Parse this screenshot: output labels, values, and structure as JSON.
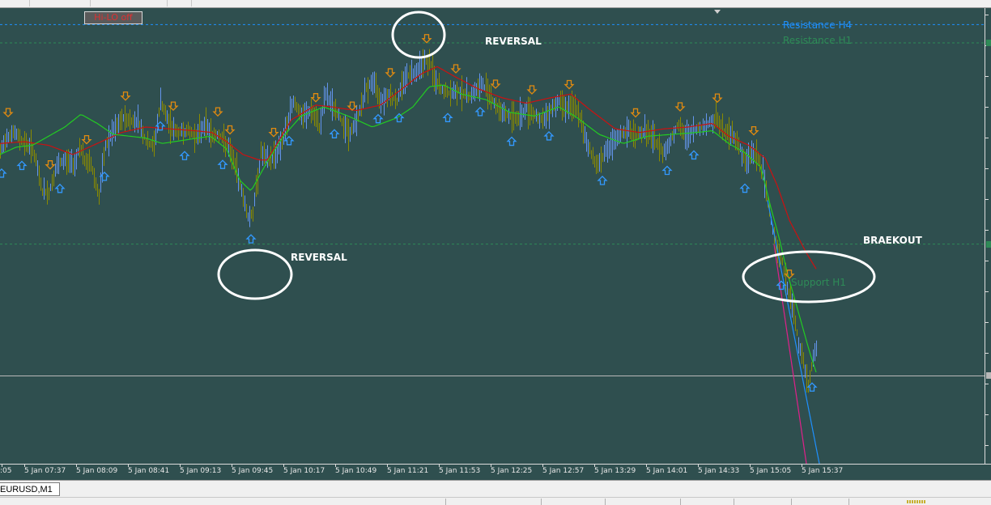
{
  "toolbar": {
    "hilo_button_label": "Hi-LO off"
  },
  "colors": {
    "background": "#2f4f4f",
    "bullish_bar": "#6495ed",
    "bearish_bar": "#8b8b00",
    "ma_fast": "#22cc22",
    "ma_slow": "#cc1111",
    "resistance_h4": "#1e90ff",
    "resistance_h1": "#2e8b57",
    "support_h1": "#2e8b57",
    "arrow_up": "#3399ff",
    "arrow_down": "#e08a10",
    "annotation": "#ffffff",
    "trend_blue": "#1e90ff",
    "trend_pink": "#e0208a"
  },
  "annotations": {
    "reversal_top": "REVERSAL",
    "reversal_bottom": "REVERSAL",
    "breakout": "BRAEKOUT"
  },
  "levels": {
    "resistance_h4": "Resistance H4",
    "resistance_h1": "Resistance H1",
    "support_h1": "Support H1"
  },
  "chart_data": {
    "type": "candlestick",
    "symbol": "EURUSD",
    "timeframe": "M1",
    "x_tick_labels": [
      ":05",
      "5 Jan 07:37",
      "5 Jan 08:09",
      "5 Jan 08:41",
      "5 Jan 09:13",
      "5 Jan 09:45",
      "5 Jan 10:17",
      "5 Jan 10:49",
      "5 Jan 11:21",
      "5 Jan 11:53",
      "5 Jan 12:25",
      "5 Jan 12:57",
      "5 Jan 13:29",
      "5 Jan 14:01",
      "5 Jan 14:33",
      "5 Jan 15:05",
      "5 Jan 15:37"
    ],
    "price_path_anchors": [
      [
        0,
        100
      ],
      [
        8,
        118
      ],
      [
        17,
        122
      ],
      [
        28,
        112
      ],
      [
        40,
        105
      ],
      [
        52,
        58
      ],
      [
        60,
        56
      ],
      [
        70,
        85
      ],
      [
        80,
        92
      ],
      [
        92,
        88
      ],
      [
        98,
        108
      ],
      [
        104,
        90
      ],
      [
        112,
        88
      ],
      [
        122,
        52
      ],
      [
        130,
        108
      ],
      [
        142,
        126
      ],
      [
        152,
        138
      ],
      [
        163,
        134
      ],
      [
        170,
        136
      ],
      [
        181,
        110
      ],
      [
        190,
        108
      ],
      [
        198,
        156
      ],
      [
        208,
        132
      ],
      [
        218,
        122
      ],
      [
        230,
        124
      ],
      [
        243,
        118
      ],
      [
        253,
        132
      ],
      [
        262,
        118
      ],
      [
        270,
        120
      ],
      [
        280,
        108
      ],
      [
        288,
        92
      ],
      [
        296,
        66
      ],
      [
        306,
        30
      ],
      [
        312,
        34
      ],
      [
        322,
        100
      ],
      [
        332,
        90
      ],
      [
        342,
        102
      ],
      [
        352,
        122
      ],
      [
        362,
        158
      ],
      [
        372,
        138
      ],
      [
        384,
        146
      ],
      [
        394,
        128
      ],
      [
        402,
        164
      ],
      [
        410,
        152
      ],
      [
        422,
        134
      ],
      [
        432,
        120
      ],
      [
        442,
        140
      ],
      [
        452,
        170
      ],
      [
        460,
        178
      ],
      [
        470,
        158
      ],
      [
        480,
        164
      ],
      [
        490,
        156
      ],
      [
        498,
        180
      ],
      [
        506,
        186
      ],
      [
        514,
        190
      ],
      [
        524,
        202
      ],
      [
        532,
        196
      ],
      [
        538,
        176
      ],
      [
        546,
        168
      ],
      [
        556,
        164
      ],
      [
        566,
        168
      ],
      [
        578,
        162
      ],
      [
        588,
        168
      ],
      [
        596,
        174
      ],
      [
        604,
        166
      ],
      [
        612,
        150
      ],
      [
        618,
        146
      ],
      [
        628,
        140
      ],
      [
        640,
        138
      ],
      [
        650,
        148
      ],
      [
        660,
        142
      ],
      [
        670,
        134
      ],
      [
        680,
        148
      ],
      [
        690,
        156
      ],
      [
        700,
        150
      ],
      [
        712,
        148
      ],
      [
        720,
        124
      ],
      [
        730,
        98
      ],
      [
        738,
        86
      ],
      [
        746,
        100
      ],
      [
        756,
        108
      ],
      [
        766,
        120
      ],
      [
        776,
        124
      ],
      [
        786,
        118
      ],
      [
        796,
        124
      ],
      [
        808,
        114
      ],
      [
        818,
        100
      ],
      [
        826,
        110
      ],
      [
        836,
        130
      ],
      [
        846,
        118
      ],
      [
        856,
        124
      ],
      [
        866,
        128
      ],
      [
        876,
        132
      ],
      [
        884,
        138
      ],
      [
        894,
        122
      ],
      [
        904,
        120
      ],
      [
        912,
        110
      ],
      [
        920,
        88
      ],
      [
        928,
        102
      ],
      [
        934,
        96
      ],
      [
        942,
        78
      ],
      [
        948,
        46
      ],
      [
        954,
        18
      ],
      [
        960,
        -8
      ],
      [
        966,
        -20
      ],
      [
        972,
        -48
      ],
      [
        980,
        -74
      ],
      [
        986,
        -108
      ],
      [
        992,
        -130
      ],
      [
        998,
        -156
      ],
      [
        1004,
        -124
      ],
      [
        1008,
        -112
      ]
    ],
    "ma_slow_anchors": [
      [
        0,
        110
      ],
      [
        30,
        112
      ],
      [
        60,
        108
      ],
      [
        90,
        98
      ],
      [
        120,
        110
      ],
      [
        150,
        122
      ],
      [
        180,
        128
      ],
      [
        210,
        126
      ],
      [
        240,
        124
      ],
      [
        262,
        122
      ],
      [
        280,
        112
      ],
      [
        300,
        98
      ],
      [
        320,
        92
      ],
      [
        330,
        92
      ],
      [
        360,
        136
      ],
      [
        390,
        152
      ],
      [
        410,
        150
      ],
      [
        440,
        146
      ],
      [
        470,
        152
      ],
      [
        500,
        172
      ],
      [
        520,
        186
      ],
      [
        540,
        194
      ],
      [
        560,
        184
      ],
      [
        590,
        170
      ],
      [
        620,
        160
      ],
      [
        650,
        154
      ],
      [
        680,
        160
      ],
      [
        705,
        164
      ],
      [
        730,
        146
      ],
      [
        760,
        126
      ],
      [
        790,
        122
      ],
      [
        820,
        126
      ],
      [
        850,
        128
      ],
      [
        880,
        132
      ],
      [
        900,
        118
      ],
      [
        925,
        108
      ],
      [
        945,
        94
      ],
      [
        960,
        64
      ],
      [
        975,
        26
      ],
      [
        995,
        -8
      ],
      [
        1010,
        -30
      ]
    ],
    "ma_fast_anchors": [
      [
        0,
        98
      ],
      [
        20,
        106
      ],
      [
        40,
        108
      ],
      [
        60,
        118
      ],
      [
        80,
        128
      ],
      [
        100,
        142
      ],
      [
        120,
        132
      ],
      [
        140,
        120
      ],
      [
        160,
        118
      ],
      [
        180,
        116
      ],
      [
        200,
        110
      ],
      [
        230,
        114
      ],
      [
        260,
        118
      ],
      [
        280,
        104
      ],
      [
        296,
        70
      ],
      [
        310,
        58
      ],
      [
        330,
        90
      ],
      [
        350,
        118
      ],
      [
        372,
        140
      ],
      [
        400,
        150
      ],
      [
        430,
        140
      ],
      [
        460,
        128
      ],
      [
        490,
        138
      ],
      [
        510,
        150
      ],
      [
        530,
        172
      ],
      [
        548,
        174
      ],
      [
        570,
        164
      ],
      [
        600,
        158
      ],
      [
        630,
        144
      ],
      [
        660,
        140
      ],
      [
        690,
        150
      ],
      [
        710,
        140
      ],
      [
        740,
        120
      ],
      [
        770,
        110
      ],
      [
        800,
        118
      ],
      [
        830,
        120
      ],
      [
        860,
        122
      ],
      [
        880,
        124
      ],
      [
        900,
        110
      ],
      [
        920,
        100
      ],
      [
        940,
        84
      ],
      [
        952,
        40
      ],
      [
        962,
        8
      ],
      [
        972,
        -30
      ],
      [
        986,
        -74
      ],
      [
        1000,
        -118
      ],
      [
        1008,
        -140
      ]
    ],
    "price_levels": {
      "resistance_h4": 240,
      "resistance_h1": 220,
      "support_h1": 0,
      "current_bid": -144
    },
    "y_range": [
      -240,
      258
    ],
    "arrows_down_at": [
      10,
      62,
      107,
      155,
      214,
      269,
      284,
      338,
      390,
      435,
      482,
      527,
      563,
      612,
      657,
      703,
      785,
      840,
      886,
      931,
      975
    ],
    "arrows_up_at": [
      2,
      27,
      74,
      129,
      198,
      228,
      275,
      310,
      357,
      413,
      467,
      493,
      553,
      593,
      632,
      678,
      744,
      824,
      857,
      920,
      965,
      1003
    ],
    "grid": false,
    "legend": "none"
  },
  "symbol_tab": {
    "label": "EURUSD,M1"
  }
}
